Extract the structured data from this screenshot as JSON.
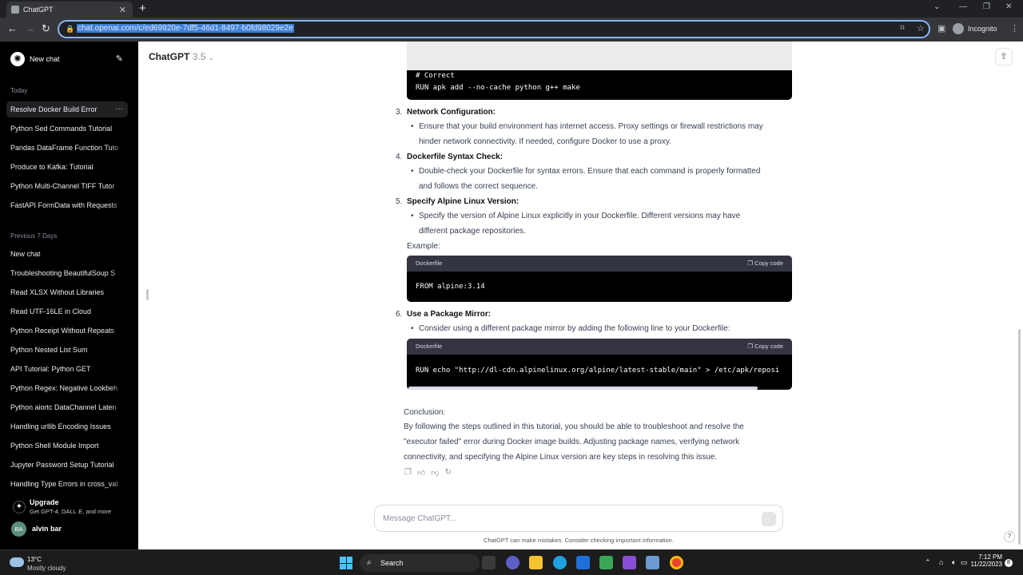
{
  "browser": {
    "tab_title": "ChatGPT",
    "url": "chat.openai.com/c/ed69920e-7df5-46d1-8497-b0fd98029e2e",
    "profile_label": "Incognito"
  },
  "sidebar": {
    "new_chat_label": "New chat",
    "section_today": "Today",
    "today_items": [
      {
        "label": "Resolve Docker Build Error",
        "active": true
      },
      {
        "label": "Python Sed Commands Tutorial"
      },
      {
        "label": "Pandas DataFrame Function Tuto"
      },
      {
        "label": "Produce to Kafka: Tutorial"
      },
      {
        "label": "Python Multi-Channel TIFF Tutor"
      },
      {
        "label": "FastAPI FormData with Requests"
      }
    ],
    "section_prev7": "Previous 7 Days",
    "prev7_items": [
      {
        "label": "New chat"
      },
      {
        "label": "Troubleshooting BeautifulSoup S"
      },
      {
        "label": "Read XLSX Without Libraries"
      },
      {
        "label": "Read UTF-16LE in Cloud"
      },
      {
        "label": "Python Receipt Without Repeats"
      },
      {
        "label": "Python Nested List Sum"
      },
      {
        "label": "API Tutorial: Python GET"
      },
      {
        "label": "Python Regex: Negative Lookbeh"
      },
      {
        "label": "Python aiortc DataChannel Laten"
      },
      {
        "label": "Handling urllib Encoding Issues"
      },
      {
        "label": "Python Shell Module Import"
      },
      {
        "label": "Jupyter Password Setup Tutorial"
      },
      {
        "label": "Handling Type Errors in cross_val"
      }
    ],
    "upgrade_title": "Upgrade",
    "upgrade_subtitle": "Get GPT-4, DALL·E, and more",
    "user_initials": "BA",
    "user_name": "alvin bar"
  },
  "header": {
    "model_name": "ChatGPT",
    "model_version": "3.5"
  },
  "content": {
    "code1_comment": "# Correct",
    "code1_line": "RUN apk add --no-cache python g++ make",
    "item3_num": "3.",
    "item3_title": "Network Configuration:",
    "item3_bullet_l1": "Ensure that your build environment has internet access. Proxy settings or firewall restrictions may",
    "item3_bullet_l2": "hinder network connectivity. If needed, configure Docker to use a proxy.",
    "item4_num": "4.",
    "item4_title": "Dockerfile Syntax Check:",
    "item4_bullet_l1": "Double-check your Dockerfile for syntax errors. Ensure that each command is properly formatted",
    "item4_bullet_l2": "and follows the correct sequence.",
    "item5_num": "5.",
    "item5_title": "Specify Alpine Linux Version:",
    "item5_bullet_l1": "Specify the version of Alpine Linux explicitly in your Dockerfile. Different versions may have",
    "item5_bullet_l2": "different package repositories.",
    "example_label": "Example:",
    "code2_lang": "Dockerfile",
    "code2_copy": "Copy code",
    "code2_line": "FROM alpine:3.14",
    "item6_num": "6.",
    "item6_title": "Use a Package Mirror:",
    "item6_bullet": "Consider using a different package mirror by adding the following line to your Dockerfile:",
    "code3_lang": "Dockerfile",
    "code3_copy": "Copy code",
    "code3_line": "RUN echo \"http://dl-cdn.alpinelinux.org/alpine/latest-stable/main\" > /etc/apk/reposi",
    "conclusion_label": "Conclusion:",
    "conclusion_l1": "By following the steps outlined in this tutorial, you should be able to troubleshoot and resolve the",
    "conclusion_l2": "\"executor failed\" error during Docker image builds. Adjusting package names, verifying network",
    "conclusion_l3": "connectivity, and specifying the Alpine Linux version are key steps in resolving this issue."
  },
  "composer": {
    "placeholder": "Message ChatGPT...",
    "disclaimer": "ChatGPT can make mistakes. Consider checking important information."
  },
  "taskbar": {
    "temperature": "13°C",
    "weather": "Mostly cloudy",
    "search_label": "Search",
    "time": "7:12 PM",
    "date": "11/22/2023",
    "notification_count": "8"
  }
}
